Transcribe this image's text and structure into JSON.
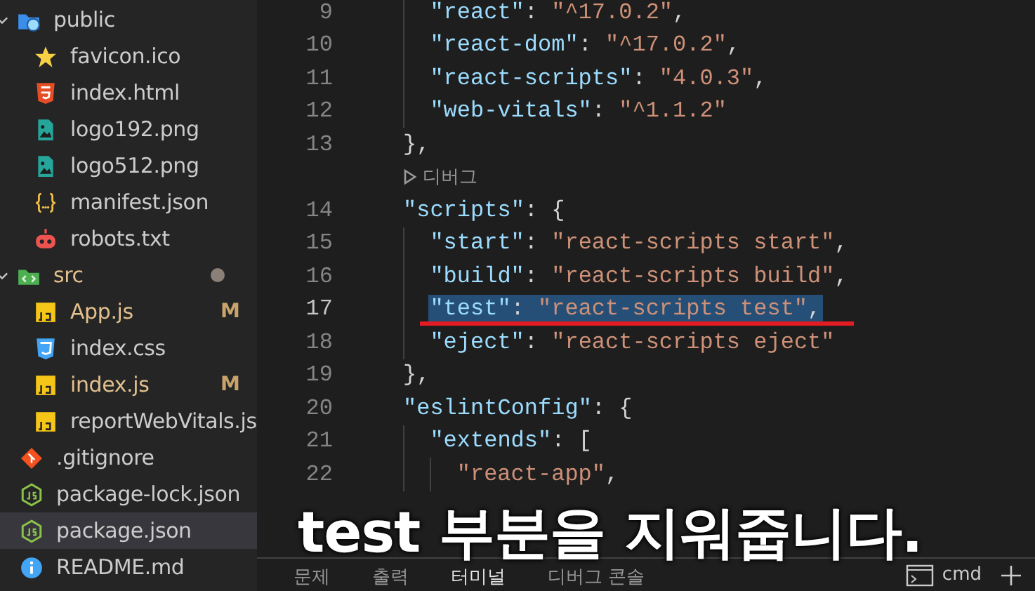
{
  "explorer": {
    "items": [
      {
        "name": "public",
        "kind": "folder-public",
        "expanded": true,
        "selected": false,
        "children": [
          {
            "name": "favicon.ico",
            "kind": "star",
            "selected": false,
            "modified": false
          },
          {
            "name": "index.html",
            "kind": "html",
            "selected": false,
            "modified": false
          },
          {
            "name": "logo192.png",
            "kind": "image",
            "selected": false,
            "modified": false
          },
          {
            "name": "logo512.png",
            "kind": "image",
            "selected": false,
            "modified": false
          },
          {
            "name": "manifest.json",
            "kind": "braces",
            "selected": false,
            "modified": false
          },
          {
            "name": "robots.txt",
            "kind": "robot",
            "selected": false,
            "modified": false
          }
        ]
      },
      {
        "name": "src",
        "kind": "folder-src",
        "expanded": true,
        "selected": false,
        "modified": true,
        "children": [
          {
            "name": "App.js",
            "kind": "js",
            "selected": false,
            "modified": true,
            "badge": "M"
          },
          {
            "name": "index.css",
            "kind": "css",
            "selected": false,
            "modified": false
          },
          {
            "name": "index.js",
            "kind": "js",
            "selected": false,
            "modified": true,
            "badge": "M"
          },
          {
            "name": "reportWebVitals.js",
            "kind": "js",
            "selected": false,
            "modified": false
          }
        ]
      },
      {
        "name": ".gitignore",
        "kind": "git",
        "selected": false,
        "modified": false
      },
      {
        "name": "package-lock.json",
        "kind": "node",
        "selected": false,
        "modified": false
      },
      {
        "name": "package.json",
        "kind": "node",
        "selected": true,
        "modified": false
      },
      {
        "name": "README.md",
        "kind": "info",
        "selected": false,
        "modified": false
      }
    ]
  },
  "editor": {
    "lines": [
      {
        "kind": "code",
        "number": "9",
        "code": "    \"react\": \"^17.0.2\",",
        "selected": false,
        "struck": false
      },
      {
        "kind": "code",
        "number": "10",
        "code": "    \"react-dom\": \"^17.0.2\",",
        "selected": false,
        "struck": false
      },
      {
        "kind": "code",
        "number": "11",
        "code": "    \"react-scripts\": \"4.0.3\",",
        "selected": false,
        "struck": false
      },
      {
        "kind": "code",
        "number": "12",
        "code": "    \"web-vitals\": \"^1.1.2\"",
        "selected": false,
        "struck": false
      },
      {
        "kind": "code",
        "number": "13",
        "code": "  },",
        "selected": false,
        "struck": false
      },
      {
        "kind": "codelens",
        "label": "디버그"
      },
      {
        "kind": "code",
        "number": "14",
        "code": "  \"scripts\": {",
        "selected": false,
        "struck": false
      },
      {
        "kind": "code",
        "number": "15",
        "code": "    \"start\": \"react-scripts start\",",
        "selected": false,
        "struck": false
      },
      {
        "kind": "code",
        "number": "16",
        "code": "    \"build\": \"react-scripts build\",",
        "selected": false,
        "struck": false
      },
      {
        "kind": "code",
        "number": "17",
        "code": "    \"test\": \"react-scripts test\",",
        "selected": true,
        "struck": true
      },
      {
        "kind": "code",
        "number": "18",
        "code": "    \"eject\": \"react-scripts eject\"",
        "selected": false,
        "struck": false
      },
      {
        "kind": "code",
        "number": "19",
        "code": "  },",
        "selected": false,
        "struck": false
      },
      {
        "kind": "code",
        "number": "20",
        "code": "  \"eslintConfig\": {",
        "selected": false,
        "struck": false
      },
      {
        "kind": "code",
        "number": "21",
        "code": "    \"extends\": [",
        "selected": false,
        "struck": false
      },
      {
        "kind": "code",
        "number": "22",
        "code": "      \"react-app\",",
        "selected": false,
        "struck": false
      }
    ]
  },
  "panel": {
    "tabs": [
      {
        "label": "문제",
        "selected": false
      },
      {
        "label": "출력",
        "selected": false
      },
      {
        "label": "터미널",
        "selected": true
      },
      {
        "label": "디버그 콘솔",
        "selected": false
      }
    ],
    "terminal": "cmd"
  },
  "caption": "test 부분을 지워줍니다."
}
